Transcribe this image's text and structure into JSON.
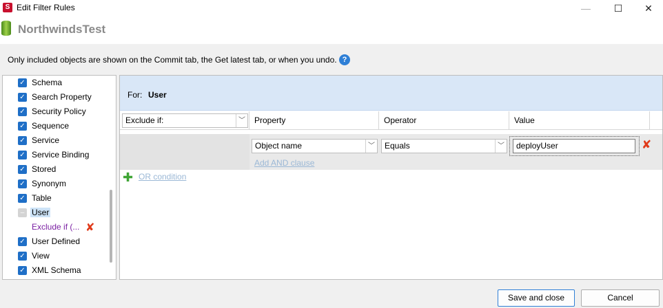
{
  "window": {
    "title": "Edit Filter Rules",
    "minimize": "—",
    "maximize": "☐",
    "close": "✕",
    "app_icon": "S"
  },
  "header": {
    "database_name": "NorthwindsTest"
  },
  "info_text": "Only included objects are shown on the Commit tab, the Get latest tab, or when you undo.",
  "help_icon": "?",
  "tree": {
    "items": [
      {
        "label": "Schema",
        "state": "checked"
      },
      {
        "label": "Search Property",
        "state": "checked"
      },
      {
        "label": "Security Policy",
        "state": "checked"
      },
      {
        "label": "Sequence",
        "state": "checked"
      },
      {
        "label": "Service",
        "state": "checked"
      },
      {
        "label": "Service Binding",
        "state": "checked"
      },
      {
        "label": "Stored",
        "state": "checked"
      },
      {
        "label": "Synonym",
        "state": "checked"
      },
      {
        "label": "Table",
        "state": "checked"
      },
      {
        "label": "User",
        "state": "partial"
      },
      {
        "label": "Exclude if (...",
        "state": "rule"
      },
      {
        "label": "User Defined",
        "state": "checked"
      },
      {
        "label": "View",
        "state": "checked"
      },
      {
        "label": "XML Schema",
        "state": "checked"
      }
    ]
  },
  "panel": {
    "for_label": "For:",
    "for_value": "User",
    "rule_type": "Exclude if:",
    "columns": {
      "property": "Property",
      "operator": "Operator",
      "value": "Value"
    },
    "condition": {
      "property": "Object name",
      "operator": "Equals",
      "value": "deployUser"
    },
    "add_and": "Add AND clause",
    "or_condition": "OR condition"
  },
  "buttons": {
    "save": "Save and close",
    "cancel": "Cancel"
  },
  "colors": {
    "accent": "#2e7fd6",
    "for_bar": "#d9e7f7",
    "delete": "#e03a1a",
    "link": "#9bb8d6",
    "rule_text": "#7a1fa2"
  }
}
